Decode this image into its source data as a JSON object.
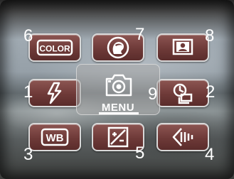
{
  "numbers": {
    "n1": "1",
    "n2": "2",
    "n3": "3",
    "n4": "4",
    "n5": "5",
    "n6": "6",
    "n7": "7",
    "n8": "8",
    "n9": "9"
  },
  "tiles": {
    "color": "COLOR",
    "wb": "WB",
    "center": "MENU"
  },
  "icons": {
    "top_left": "color-mode-icon",
    "top_middle": "portrait-scene-icon",
    "top_right": "spot-ae-icon",
    "mid_left": "flash-icon",
    "mid_right": "self-timer-drive-icon",
    "bottom_left": "white-balance-icon",
    "bottom_middle": "exposure-compensation-icon",
    "bottom_right": "sharpness-contrast-icon",
    "center": "camera-icon"
  },
  "colors": {
    "tile_fill": "#6e3a38",
    "tile_border": "#d8d8d8",
    "label_text": "#ffffff"
  }
}
